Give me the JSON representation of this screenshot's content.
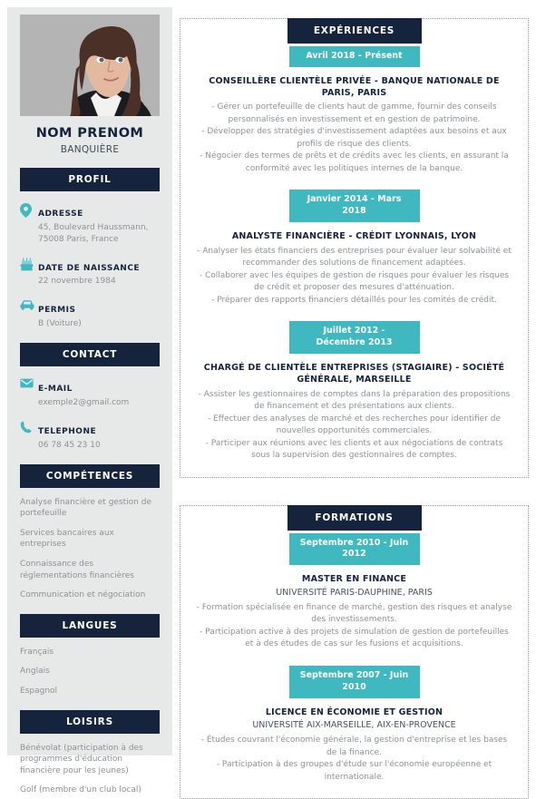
{
  "sidebar": {
    "photo_alt": "profile-photo",
    "name": "NOM PRENOM",
    "job_title": "BANQUIÈRE",
    "profil_heading": "PROFIL",
    "contact_heading": "CONTACT",
    "competences_heading": "COMPÉTENCES",
    "langues_heading": "LANGUES",
    "loisirs_heading": "LOISIRS",
    "profil_items": [
      {
        "icon": "location-pin-icon",
        "label": "ADRESSE",
        "value": "45, Boulevard Haussmann, 75008 Paris, France"
      },
      {
        "icon": "birthday-cake-icon",
        "label": "DATE DE NAISSANCE",
        "value": "22 novembre 1984"
      },
      {
        "icon": "car-icon",
        "label": "PERMIS",
        "value": "B (Voiture)"
      }
    ],
    "contact_items": [
      {
        "icon": "envelope-icon",
        "label": "E-MAIL",
        "value": "exemple2@gmail.com"
      },
      {
        "icon": "phone-icon",
        "label": "TELEPHONE",
        "value": "06 78 45 23 10"
      }
    ],
    "competences": [
      "Analyse financière et gestion de portefeuille",
      "Services bancaires aux entreprises",
      "Connaissance des réglementations financières",
      "Communication et négociation"
    ],
    "langues": [
      "Français",
      "Anglais",
      "Espagnol"
    ],
    "loisirs": [
      "Bénévolat (participation à des programmes d'éducation financière pour les jeunes)",
      "Golf (membre d'un club local)"
    ]
  },
  "main": {
    "experiences": {
      "heading": "EXPÉRIENCES",
      "entries": [
        {
          "date": "Avril 2018 - Présent",
          "title": "CONSEILLÈRE CLIENTÈLE PRIVÉE - BANQUE NATIONALE DE PARIS, PARIS",
          "org": "",
          "description": "- Gérer un portefeuille de clients haut de gamme, fournir des conseils personnalisés en investissement et en gestion de patrimoine.\n- Développer des stratégies d'investissement adaptées aux besoins et aux profils de risque des clients.\n- Négocier des termes de prêts et de crédits avec les clients, en assurant la conformité avec les politiques internes de la banque."
        },
        {
          "date": "Janvier 2014 - Mars 2018",
          "title": "ANALYSTE FINANCIÈRE - CRÉDIT LYONNAIS, LYON",
          "org": "",
          "description": "- Analyser les états financiers des entreprises pour évaluer leur solvabilité et recommander des solutions de financement adaptées.\n- Collaborer avec les équipes de gestion de risques pour évaluer les risques de crédit et proposer des mesures d'atténuation.\n- Préparer des rapports financiers détaillés pour les comités de crédit."
        },
        {
          "date": "Juillet 2012 - Décembre 2013",
          "title": "CHARGÉ DE CLIENTÈLE ENTREPRISES (STAGIAIRE) - SOCIÉTÉ GÉNÉRALE, MARSEILLE",
          "org": "",
          "description": "- Assister les gestionnaires de comptes dans la préparation des propositions de financement et des présentations aux clients.\n- Effectuer des analyses de marché et des recherches pour identifier de nouvelles opportunités commerciales.\n- Participer aux réunions avec les clients et aux négociations de contrats sous la supervision des gestionnaires de comptes."
        }
      ]
    },
    "formations": {
      "heading": "FORMATIONS",
      "entries": [
        {
          "date": "Septembre 2010 - Juin 2012",
          "title": "MASTER EN FINANCE",
          "org": "UNIVERSITÉ PARIS-DAUPHINE, PARIS",
          "description": "- Formation spécialisée en finance de marché, gestion des risques et analyse des investissements.\n- Participation active à des projets de simulation de gestion de portefeuilles et à des études de cas sur les fusions et acquisitions."
        },
        {
          "date": "Septembre 2007 - Juin 2010",
          "title": "LICENCE EN ÉCONOMIE ET GESTION",
          "org": "UNIVERSITÉ AIX-MARSEILLE, AIX-EN-PROVENCE",
          "description": "- Études couvrant l'économie générale, la gestion d'entreprise et les bases de la finance.\n- Participation à des groupes d'étude sur l'économie européenne et internationale."
        }
      ]
    }
  },
  "colors": {
    "navy": "#15233c",
    "teal": "#3fb8c0",
    "sidebar_bg": "#e7e9e9",
    "muted_text": "#8d9195"
  }
}
